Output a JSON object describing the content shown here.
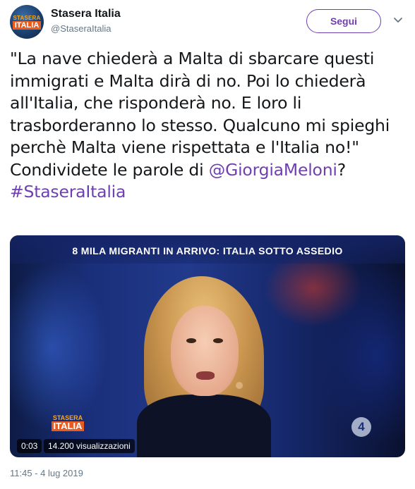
{
  "account": {
    "avatar_text_top": "STASERA",
    "avatar_text_bottom": "ITALIA",
    "name": "Stasera Italia",
    "handle": "@StaseraItalia"
  },
  "follow_label": "Segui",
  "tweet": {
    "quote": "\"La nave chiederà a Malta di sbarcare questi immigrati e Malta dirà di no. Poi lo chiederà all'Italia, che risponderà no. E loro li trasborderanno lo stesso. Qualcuno mi spieghi perchè Malta viene rispettata e l'Italia no!\"",
    "line_prefix": "Condividete le parole di ",
    "mention": "@GiorgiaMeloni",
    "line_suffix": "?",
    "hashtag": "#StaseraItalia"
  },
  "media": {
    "banner": "8 MILA MIGRANTI IN ARRIVO: ITALIA SOTTO ASSEDIO",
    "logo_top": "STASERA",
    "logo_bottom": "ITALIA",
    "channel_logo": "4",
    "duration": "0:03",
    "views": "14.200 visualizzazioni"
  },
  "timestamp": "11:45 - 4 lug 2019",
  "colors": {
    "accent": "#6f3fb1",
    "muted": "#657786",
    "text": "#14171a"
  },
  "icons": {
    "caret": "chevron-down-icon"
  }
}
